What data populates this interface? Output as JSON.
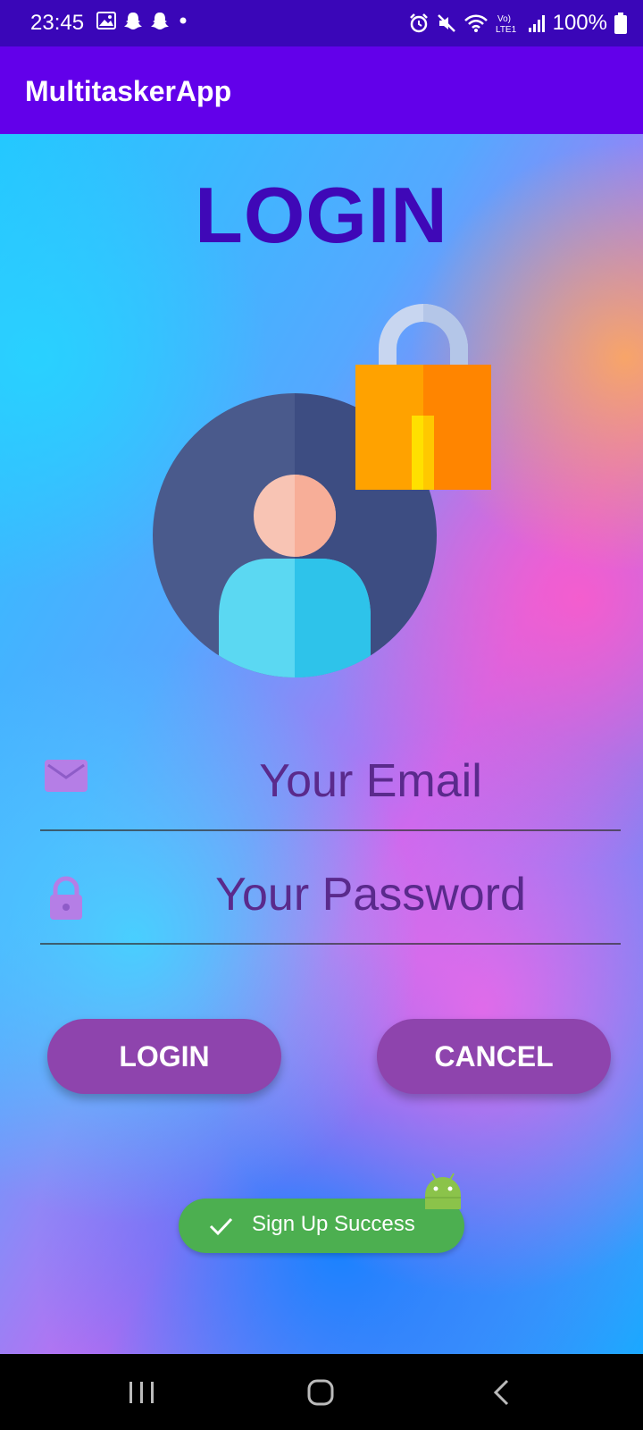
{
  "status_bar": {
    "time": "23:45",
    "battery": "100%",
    "left_icons": [
      "image-icon",
      "snapchat-icon",
      "snapchat-icon",
      "dot-icon"
    ],
    "right_icons": [
      "alarm-icon",
      "mute-icon",
      "wifi-icon",
      "volte-icon",
      "signal-icon",
      "battery-icon"
    ]
  },
  "app_bar": {
    "title": "MultitaskerApp",
    "background": "#6200ea"
  },
  "login": {
    "title": "LOGIN",
    "title_color": "#3f08b7",
    "email_placeholder": "Your Email",
    "password_placeholder": "Your Password",
    "login_button": "LOGIN",
    "cancel_button": "CANCEL",
    "button_color": "#8e44ad"
  },
  "toast": {
    "text": "Sign Up Success",
    "color": "#4caf50"
  },
  "nav_bar": {
    "icons": [
      "recent-apps-icon",
      "home-icon",
      "back-icon"
    ]
  }
}
